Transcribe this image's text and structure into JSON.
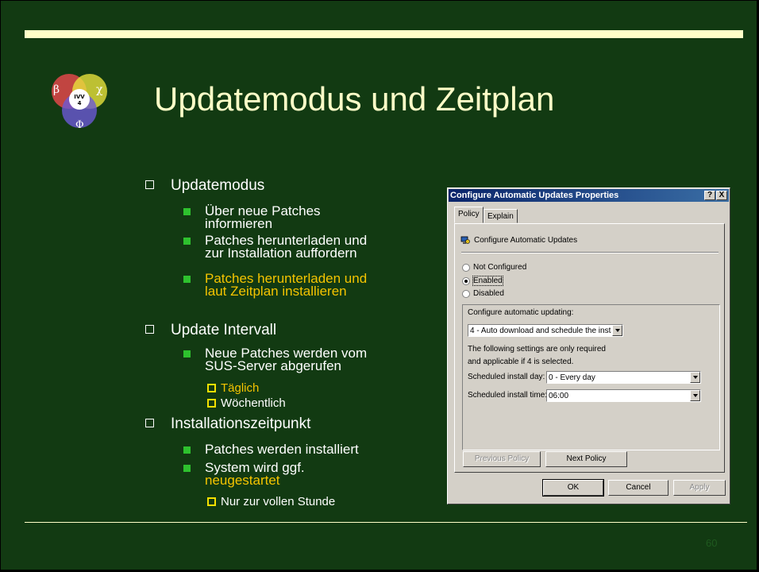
{
  "title": "Updatemodus und Zeitplan",
  "page_number": "60",
  "logo": {
    "symbols": [
      "β",
      "χ",
      "Φ"
    ],
    "center_text_1": "IVV",
    "center_text_2": "4"
  },
  "bullets": {
    "updatemodus": "Updatemodus",
    "u1_line1": "Über neue Patches",
    "u1_line2": "informieren",
    "u2_line1": "Patches herunterladen und",
    "u2_line2": "zur Installation auffordern",
    "u3_line1": "Patches herunterladen und",
    "u3_line2": "laut Zeitplan installieren",
    "update_intervall": "Update Intervall",
    "i1_line1": "Neue Patches werden vom",
    "i1_line2": "SUS-Server abgerufen",
    "i1_sub1": "Täglich",
    "i1_sub2": "Wöchentlich",
    "installationszeitpunkt": "Installationszeitpunkt",
    "z1": "Patches werden installiert",
    "z2_line1": "System wird ggf.",
    "z2_line2": "neugestartet",
    "z2_sub1": "Nur zur vollen Stunde"
  },
  "dialog": {
    "title": "Configure Automatic Updates Properties",
    "help_btn": "?",
    "close_btn": "X",
    "tabs": [
      "Policy",
      "Explain"
    ],
    "heading": "Configure Automatic Updates",
    "radios": [
      "Not Configured",
      "Enabled",
      "Disabled"
    ],
    "selected_radio": "Enabled",
    "configure_label": "Configure automatic updating:",
    "configure_value": "4 - Auto download and schedule the insta",
    "info_line1": "The following settings are only required",
    "info_line2": "and applicable if 4 is selected.",
    "day_label": "Scheduled install day:",
    "day_value": "0 - Every day",
    "time_label": "Scheduled install time:",
    "time_value": "06:00",
    "prev_policy": "Previous Policy",
    "next_policy": "Next Policy",
    "ok": "OK",
    "cancel": "Cancel",
    "apply": "Apply"
  }
}
